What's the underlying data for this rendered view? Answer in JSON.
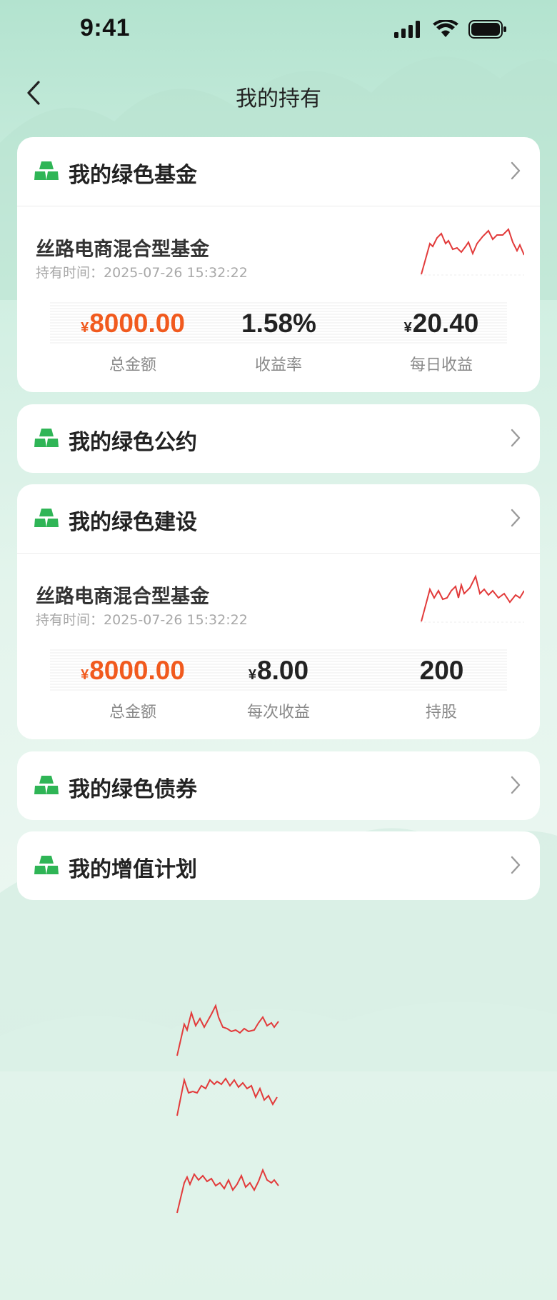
{
  "status_bar": {
    "time": "9:41"
  },
  "nav": {
    "title": "我的持有"
  },
  "sections": {
    "fund": {
      "title": "我的绿色基金",
      "holding": {
        "name": "丝路电商混合型基金",
        "time_label": "持有时间：",
        "time_value": "2025-07-26 15:32:22",
        "stat1": {
          "currency": "¥",
          "value": "8000.00",
          "label": "总金额"
        },
        "stat2": {
          "currency": "",
          "value": "1.58%",
          "label": "收益率"
        },
        "stat3": {
          "currency": "¥",
          "value": "20.40",
          "label": "每日收益"
        }
      }
    },
    "pact": {
      "title": "我的绿色公约"
    },
    "construction": {
      "title": "我的绿色建设",
      "holding": {
        "name": "丝路电商混合型基金",
        "time_label": "持有时间：",
        "time_value": "2025-07-26 15:32:22",
        "stat1": {
          "currency": "¥",
          "value": "8000.00",
          "label": "总金额"
        },
        "stat2": {
          "currency": "¥",
          "value": "8.00",
          "label": "每次收益"
        },
        "stat3": {
          "currency": "",
          "value": "200",
          "label": "持股"
        }
      }
    },
    "bond": {
      "title": "我的绿色债券"
    },
    "plan": {
      "title": "我的增值计划"
    }
  },
  "colors": {
    "accent_green": "#2fb556",
    "value_orange": "#f15a1e",
    "sparkline_red": "#e23b3b"
  },
  "icons": {
    "section": "gold-bars-icon",
    "chevron": "chevron-right-icon",
    "back": "back-arrow-icon"
  }
}
